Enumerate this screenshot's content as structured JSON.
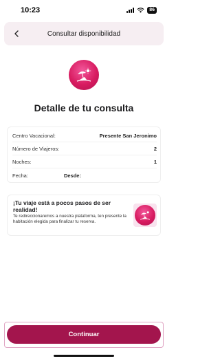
{
  "status_bar": {
    "time": "10:23",
    "battery": "86",
    "icons": [
      "signal-icon",
      "wifi-icon",
      "battery-icon"
    ]
  },
  "header": {
    "title": "Consultar disponibilidad",
    "back_icon": "chevron-left-icon"
  },
  "logo_icon": "beach-umbrella-icon",
  "page_title": "Detalle de tu consulta",
  "details": {
    "centro_label": "Centro Vacacional:",
    "centro_value": "Presente San Jeronimo",
    "viajeros_label": "Número de Viajeros:",
    "viajeros_value": "2",
    "noches_label": "Noches:",
    "noches_value": "1",
    "fecha_label": "Fecha:",
    "fecha_desde": "Desde:"
  },
  "info": {
    "title": "¡Tu viaje está a pocos pasos de ser realidad!",
    "text": "Te redireccionaremos a nuestra plataforma, ten presente la habitación elegida para finalizar tu reserva.",
    "image_icon": "beach-umbrella-icon"
  },
  "continue_label": "Continuar",
  "colors": {
    "accent": "#a3154d",
    "header_bg": "#f6eef2",
    "logo_pink": "#d81b60"
  }
}
